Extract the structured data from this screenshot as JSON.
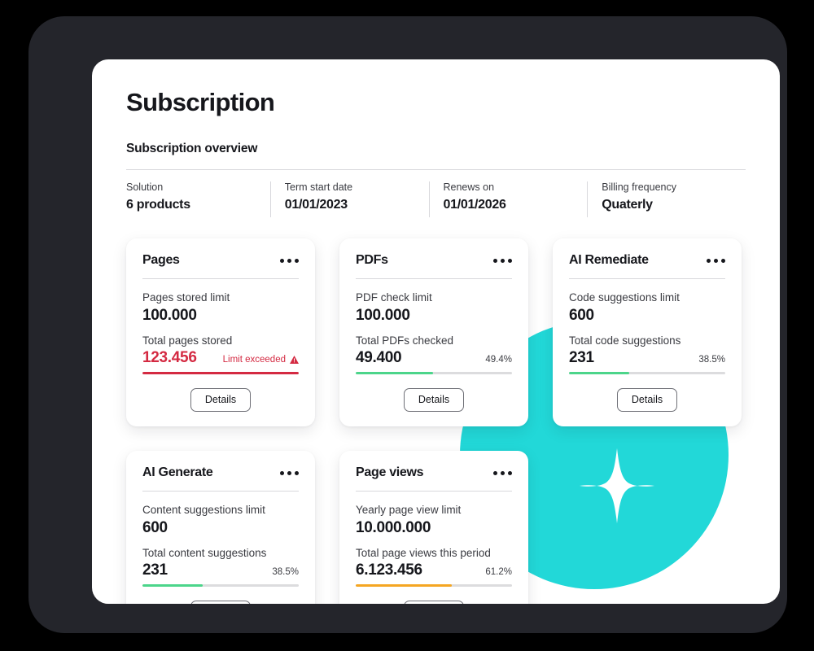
{
  "page": {
    "title": "Subscription",
    "section_title": "Subscription overview"
  },
  "colors": {
    "accent_teal": "#22D8D8",
    "danger_red": "#D42A42",
    "success_green": "#4CD58A",
    "warning_orange": "#F5A623",
    "track_gray": "#DCDCDE",
    "bezel_dark": "#24252B"
  },
  "overview": [
    {
      "label": "Solution",
      "value": "6 products"
    },
    {
      "label": "Term start date",
      "value": "01/01/2023"
    },
    {
      "label": "Renews on",
      "value": "01/01/2026"
    },
    {
      "label": "Billing frequency",
      "value": "Quaterly"
    }
  ],
  "details_label": "Details",
  "cards": [
    {
      "title": "Pages",
      "limit_label": "Pages stored limit",
      "limit_value": "100.000",
      "usage_label": "Total pages stored",
      "usage_value": "123.456",
      "status_text": "Limit exceeded",
      "percent_text": "",
      "bar_percent": 100,
      "bar_color": "#D42A42",
      "state": "exceeded"
    },
    {
      "title": "PDFs",
      "limit_label": "PDF check limit",
      "limit_value": "100.000",
      "usage_label": "Total PDFs checked",
      "usage_value": "49.400",
      "status_text": "",
      "percent_text": "49.4%",
      "bar_percent": 49.4,
      "bar_color": "#4CD58A",
      "state": "ok"
    },
    {
      "title": "AI Remediate",
      "limit_label": "Code suggestions limit",
      "limit_value": "600",
      "usage_label": "Total code suggestions",
      "usage_value": "231",
      "status_text": "",
      "percent_text": "38.5%",
      "bar_percent": 38.5,
      "bar_color": "#4CD58A",
      "state": "ok"
    },
    {
      "title": "AI Generate",
      "limit_label": "Content suggestions limit",
      "limit_value": "600",
      "usage_label": "Total content suggestions",
      "usage_value": "231",
      "status_text": "",
      "percent_text": "38.5%",
      "bar_percent": 38.5,
      "bar_color": "#4CD58A",
      "state": "ok"
    },
    {
      "title": "Page views",
      "limit_label": "Yearly page view limit",
      "limit_value": "10.000.000",
      "usage_label": "Total page views this period",
      "usage_value": "6.123.456",
      "status_text": "",
      "percent_text": "61.2%",
      "bar_percent": 61.2,
      "bar_color": "#F5A623",
      "state": "ok"
    }
  ],
  "decor": {
    "circle_name": "teal-circle-decoration",
    "sparkle_name": "sparkle-icon"
  }
}
